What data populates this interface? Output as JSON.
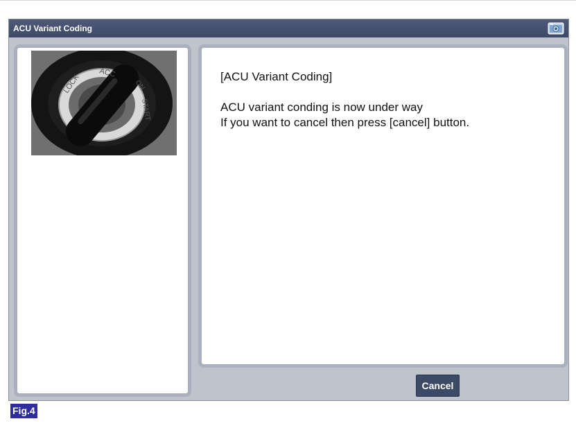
{
  "window": {
    "title": "ACU Variant Coding",
    "camera_icon": "camera-icon"
  },
  "left_panel": {
    "image_icon": "ignition-key-switch-image",
    "switch_labels": [
      "LOCK",
      "ACC",
      "ON",
      "START"
    ]
  },
  "message": {
    "title": "[ACU Variant Coding]",
    "line1": "ACU variant conding is now under way",
    "line2": "If you want to cancel then press [cancel] button."
  },
  "buttons": {
    "cancel_label": "Cancel"
  },
  "figure": {
    "label": "Fig.4"
  },
  "colors": {
    "titlebar": "#44506e",
    "button": "#3d4a66",
    "panel_border": "#aab0bd",
    "window_bg": "#bfc4cc",
    "fig_label_bg": "#2d2da0"
  }
}
